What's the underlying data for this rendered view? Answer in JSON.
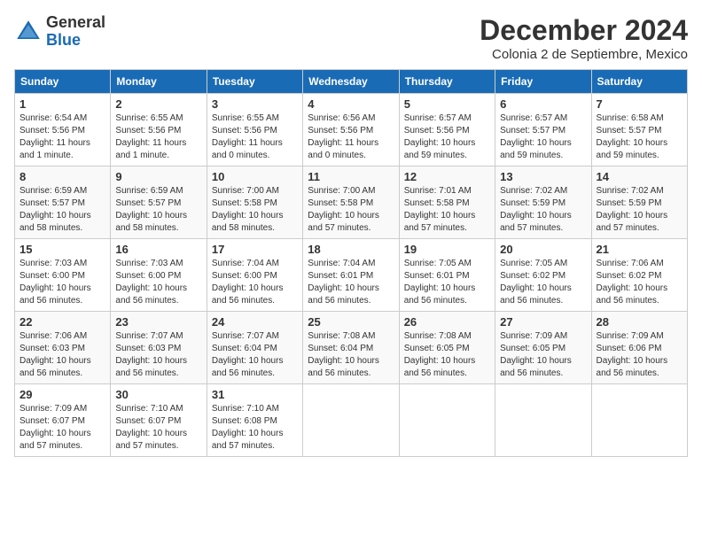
{
  "logo": {
    "general": "General",
    "blue": "Blue"
  },
  "title": "December 2024",
  "location": "Colonia 2 de Septiembre, Mexico",
  "weekdays": [
    "Sunday",
    "Monday",
    "Tuesday",
    "Wednesday",
    "Thursday",
    "Friday",
    "Saturday"
  ],
  "weeks": [
    [
      {
        "day": "1",
        "sunrise": "6:54 AM",
        "sunset": "5:56 PM",
        "daylight": "11 hours and 1 minute."
      },
      {
        "day": "2",
        "sunrise": "6:55 AM",
        "sunset": "5:56 PM",
        "daylight": "11 hours and 1 minute."
      },
      {
        "day": "3",
        "sunrise": "6:55 AM",
        "sunset": "5:56 PM",
        "daylight": "11 hours and 0 minutes."
      },
      {
        "day": "4",
        "sunrise": "6:56 AM",
        "sunset": "5:56 PM",
        "daylight": "11 hours and 0 minutes."
      },
      {
        "day": "5",
        "sunrise": "6:57 AM",
        "sunset": "5:56 PM",
        "daylight": "10 hours and 59 minutes."
      },
      {
        "day": "6",
        "sunrise": "6:57 AM",
        "sunset": "5:57 PM",
        "daylight": "10 hours and 59 minutes."
      },
      {
        "day": "7",
        "sunrise": "6:58 AM",
        "sunset": "5:57 PM",
        "daylight": "10 hours and 59 minutes."
      }
    ],
    [
      {
        "day": "8",
        "sunrise": "6:59 AM",
        "sunset": "5:57 PM",
        "daylight": "10 hours and 58 minutes."
      },
      {
        "day": "9",
        "sunrise": "6:59 AM",
        "sunset": "5:57 PM",
        "daylight": "10 hours and 58 minutes."
      },
      {
        "day": "10",
        "sunrise": "7:00 AM",
        "sunset": "5:58 PM",
        "daylight": "10 hours and 58 minutes."
      },
      {
        "day": "11",
        "sunrise": "7:00 AM",
        "sunset": "5:58 PM",
        "daylight": "10 hours and 57 minutes."
      },
      {
        "day": "12",
        "sunrise": "7:01 AM",
        "sunset": "5:58 PM",
        "daylight": "10 hours and 57 minutes."
      },
      {
        "day": "13",
        "sunrise": "7:02 AM",
        "sunset": "5:59 PM",
        "daylight": "10 hours and 57 minutes."
      },
      {
        "day": "14",
        "sunrise": "7:02 AM",
        "sunset": "5:59 PM",
        "daylight": "10 hours and 57 minutes."
      }
    ],
    [
      {
        "day": "15",
        "sunrise": "7:03 AM",
        "sunset": "6:00 PM",
        "daylight": "10 hours and 56 minutes."
      },
      {
        "day": "16",
        "sunrise": "7:03 AM",
        "sunset": "6:00 PM",
        "daylight": "10 hours and 56 minutes."
      },
      {
        "day": "17",
        "sunrise": "7:04 AM",
        "sunset": "6:00 PM",
        "daylight": "10 hours and 56 minutes."
      },
      {
        "day": "18",
        "sunrise": "7:04 AM",
        "sunset": "6:01 PM",
        "daylight": "10 hours and 56 minutes."
      },
      {
        "day": "19",
        "sunrise": "7:05 AM",
        "sunset": "6:01 PM",
        "daylight": "10 hours and 56 minutes."
      },
      {
        "day": "20",
        "sunrise": "7:05 AM",
        "sunset": "6:02 PM",
        "daylight": "10 hours and 56 minutes."
      },
      {
        "day": "21",
        "sunrise": "7:06 AM",
        "sunset": "6:02 PM",
        "daylight": "10 hours and 56 minutes."
      }
    ],
    [
      {
        "day": "22",
        "sunrise": "7:06 AM",
        "sunset": "6:03 PM",
        "daylight": "10 hours and 56 minutes."
      },
      {
        "day": "23",
        "sunrise": "7:07 AM",
        "sunset": "6:03 PM",
        "daylight": "10 hours and 56 minutes."
      },
      {
        "day": "24",
        "sunrise": "7:07 AM",
        "sunset": "6:04 PM",
        "daylight": "10 hours and 56 minutes."
      },
      {
        "day": "25",
        "sunrise": "7:08 AM",
        "sunset": "6:04 PM",
        "daylight": "10 hours and 56 minutes."
      },
      {
        "day": "26",
        "sunrise": "7:08 AM",
        "sunset": "6:05 PM",
        "daylight": "10 hours and 56 minutes."
      },
      {
        "day": "27",
        "sunrise": "7:09 AM",
        "sunset": "6:05 PM",
        "daylight": "10 hours and 56 minutes."
      },
      {
        "day": "28",
        "sunrise": "7:09 AM",
        "sunset": "6:06 PM",
        "daylight": "10 hours and 56 minutes."
      }
    ],
    [
      {
        "day": "29",
        "sunrise": "7:09 AM",
        "sunset": "6:07 PM",
        "daylight": "10 hours and 57 minutes."
      },
      {
        "day": "30",
        "sunrise": "7:10 AM",
        "sunset": "6:07 PM",
        "daylight": "10 hours and 57 minutes."
      },
      {
        "day": "31",
        "sunrise": "7:10 AM",
        "sunset": "6:08 PM",
        "daylight": "10 hours and 57 minutes."
      },
      null,
      null,
      null,
      null
    ]
  ]
}
